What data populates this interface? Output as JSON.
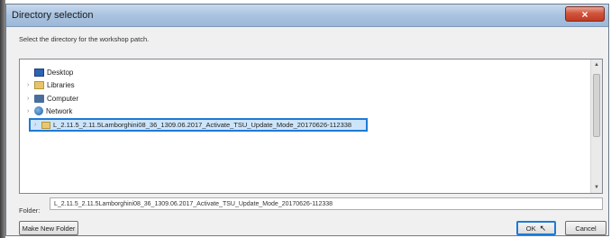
{
  "dialog": {
    "title": "Directory selection",
    "close_label": "×",
    "instruction": "Select the directory for the workshop patch."
  },
  "tree": {
    "items": [
      {
        "label": "Desktop",
        "icon": "desktop-icon",
        "expand": ""
      },
      {
        "label": "Libraries",
        "icon": "libraries-icon",
        "expand": "›"
      },
      {
        "label": "Computer",
        "icon": "computer-icon",
        "expand": "›"
      },
      {
        "label": "Network",
        "icon": "network-icon",
        "expand": "›"
      }
    ],
    "selected_label": "L_2.11.5_2.11.5Lamborghini08_36_1309.06.2017_Activate_TSU_Update_Mode_20170626-112338",
    "selected_expand": "›"
  },
  "scrollbar": {
    "up": "▲",
    "down": "▼"
  },
  "folder": {
    "label": "Folder:",
    "value": "L_2.11.5_2.11.5Lamborghini08_36_1309.06.2017_Activate_TSU_Update_Mode_20170626-112338"
  },
  "buttons": {
    "new_folder": "Make New Folder",
    "ok": "OK",
    "cancel": "Cancel"
  },
  "colors": {
    "selection_border": "#1e7ad6",
    "selection_fill": "#cde5fb",
    "close_button": "#c23a22"
  }
}
